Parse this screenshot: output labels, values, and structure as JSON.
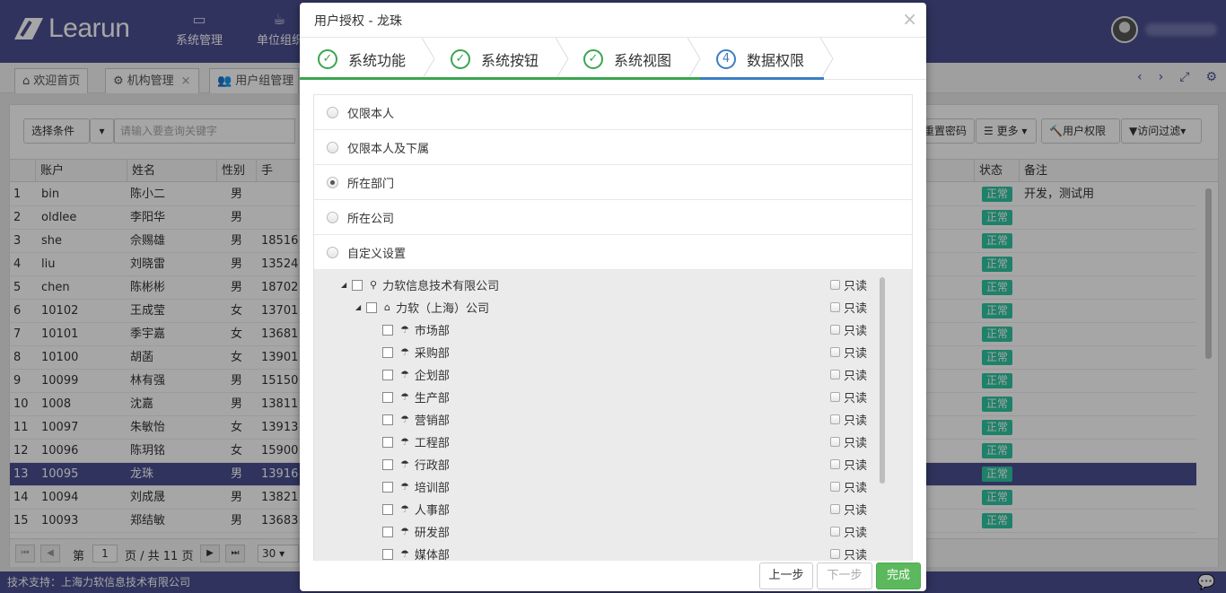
{
  "app": {
    "logo_text": "Learun",
    "top_menu": [
      "系统管理",
      "单位组织"
    ]
  },
  "tabs": [
    {
      "label": "欢迎首页"
    },
    {
      "label": "机构管理"
    },
    {
      "label": "用户组管理"
    }
  ],
  "toolbar": {
    "select_label": "选择条件",
    "search_placeholder": "请输入要查询关键字",
    "reset_pwd": "重置密码",
    "more": "更多",
    "user_auth": "用户权限",
    "access_filter": "访问过滤"
  },
  "grid": {
    "headers": {
      "account": "账户",
      "name": "姓名",
      "gender": "性别",
      "phone": "手",
      "status": "状态",
      "remark": "备注"
    },
    "rows": [
      {
        "no": "1",
        "account": "bin",
        "name": "陈小二",
        "gender": "男",
        "phone": "",
        "status": "正常",
        "remark": "开发，测试用"
      },
      {
        "no": "2",
        "account": "oldlee",
        "name": "李阳华",
        "gender": "男",
        "phone": "",
        "status": "正常",
        "remark": ""
      },
      {
        "no": "3",
        "account": "she",
        "name": "佘赐雄",
        "gender": "男",
        "phone": "18516",
        "status": "正常",
        "remark": ""
      },
      {
        "no": "4",
        "account": "liu",
        "name": "刘晓雷",
        "gender": "男",
        "phone": "13524",
        "status": "正常",
        "remark": ""
      },
      {
        "no": "5",
        "account": "chen",
        "name": "陈彬彬",
        "gender": "男",
        "phone": "18702",
        "status": "正常",
        "remark": ""
      },
      {
        "no": "6",
        "account": "10102",
        "name": "王成莹",
        "gender": "女",
        "phone": "13701",
        "status": "正常",
        "remark": ""
      },
      {
        "no": "7",
        "account": "10101",
        "name": "季宇嘉",
        "gender": "女",
        "phone": "13681",
        "status": "正常",
        "remark": ""
      },
      {
        "no": "8",
        "account": "10100",
        "name": "胡菡",
        "gender": "女",
        "phone": "13901",
        "status": "正常",
        "remark": ""
      },
      {
        "no": "9",
        "account": "10099",
        "name": "林有强",
        "gender": "男",
        "phone": "15150",
        "status": "正常",
        "remark": ""
      },
      {
        "no": "10",
        "account": "1008",
        "name": "沈嘉",
        "gender": "男",
        "phone": "13811",
        "status": "正常",
        "remark": ""
      },
      {
        "no": "11",
        "account": "10097",
        "name": "朱敏怡",
        "gender": "女",
        "phone": "13913",
        "status": "正常",
        "remark": ""
      },
      {
        "no": "12",
        "account": "10096",
        "name": "陈玥铭",
        "gender": "女",
        "phone": "15900",
        "status": "正常",
        "remark": ""
      },
      {
        "no": "13",
        "account": "10095",
        "name": "龙珠",
        "gender": "男",
        "phone": "13916",
        "status": "正常",
        "remark": ""
      },
      {
        "no": "14",
        "account": "10094",
        "name": "刘成晟",
        "gender": "男",
        "phone": "13821",
        "status": "正常",
        "remark": ""
      },
      {
        "no": "15",
        "account": "10093",
        "name": "郑结敏",
        "gender": "男",
        "phone": "13683",
        "status": "正常",
        "remark": ""
      }
    ],
    "selected_index": 12
  },
  "pager": {
    "page_prefix": "第",
    "page": "1",
    "page_suffix": "页 / 共 11 页",
    "page_size": "30"
  },
  "footer": {
    "text": "技术支持：上海力软信息技术有限公司"
  },
  "modal": {
    "title": "用户授权 - 龙珠",
    "steps": [
      {
        "label": "系统功能",
        "state": "done"
      },
      {
        "label": "系统按钮",
        "state": "done"
      },
      {
        "label": "系统视图",
        "state": "done"
      },
      {
        "label": "数据权限",
        "state": "active",
        "num": "4"
      }
    ],
    "options": [
      "仅限本人",
      "仅限本人及下属",
      "所在部门",
      "所在公司",
      "自定义设置"
    ],
    "selected_option": 2,
    "tree": {
      "root": "力软信息技术有限公司",
      "company": "力软（上海）公司",
      "departments": [
        "市场部",
        "采购部",
        "企划部",
        "生产部",
        "营销部",
        "工程部",
        "行政部",
        "培训部",
        "人事部",
        "研发部",
        "媒体部"
      ],
      "readonly_label": "只读"
    },
    "buttons": {
      "prev": "上一步",
      "next": "下一步",
      "finish": "完成"
    }
  },
  "colors": {
    "brand": "#4b4f91",
    "success": "#2ec7a2",
    "step_done": "#3aa54f",
    "step_active": "#3a7fc4",
    "finish_btn": "#5cb85c"
  }
}
